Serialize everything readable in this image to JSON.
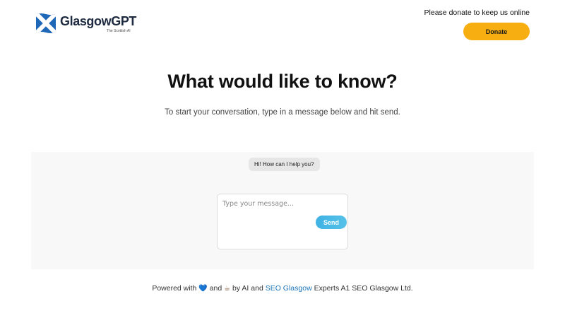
{
  "header": {
    "logo_name": "GlasgowGPT",
    "logo_tagline": "The Scottish AI",
    "donate_message": "Please donate to keep us online",
    "donate_button": "Donate"
  },
  "hero": {
    "title": "What would like to know?",
    "subtitle": "To start your conversation, type in a message below and hit send."
  },
  "chat": {
    "bot_greeting": "Hi! How can I help you?",
    "input_placeholder": "Type your message...",
    "input_value": "",
    "send_button": "Send"
  },
  "footer": {
    "powered_prefix": "Powered with",
    "heart_emoji": "💙",
    "and_text": "and",
    "coffee_emoji": "☕",
    "by_text": "by AI and",
    "link_text": "SEO Glasgow",
    "suffix": "Experts A1 SEO Glasgow Ltd."
  },
  "colors": {
    "accent": "#f7ae10",
    "send_button": "#47b8e6",
    "link": "#1a73b8",
    "brand_blue": "#1f67b7"
  },
  "icons": {
    "logo": "saltire-flag-icon",
    "heart": "blue-heart-emoji",
    "coffee": "coffee-cup-emoji"
  }
}
